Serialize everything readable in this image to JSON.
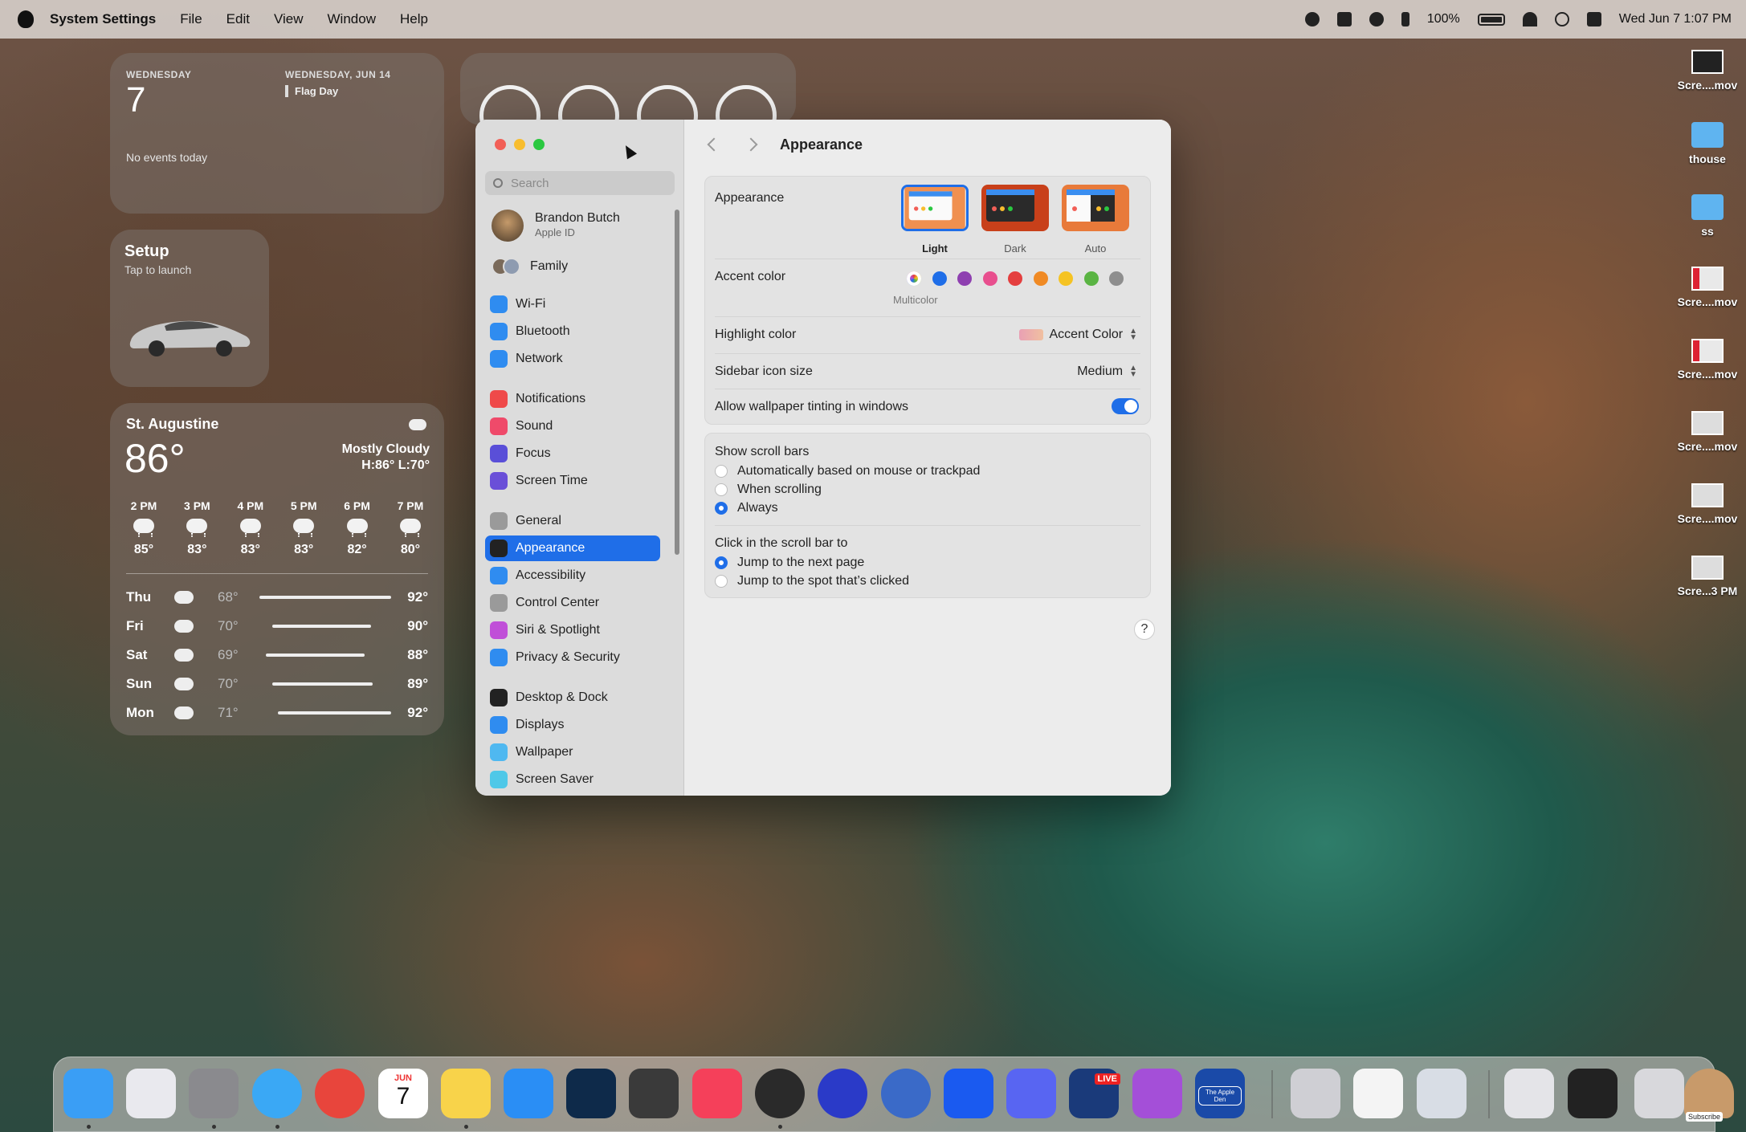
{
  "menubar": {
    "app_name": "System Settings",
    "menus": [
      "File",
      "Edit",
      "View",
      "Window",
      "Help"
    ],
    "battery": "100%",
    "clock": "Wed Jun 7  1:07 PM",
    "status_icons": [
      "screen-record-icon",
      "dropbox-icon",
      "play-icon",
      "bluetooth-icon",
      "battery-icon",
      "wifi-icon",
      "spotlight-icon",
      "control-center-icon"
    ]
  },
  "calendar_widget": {
    "today_dow": "WEDNESDAY",
    "today_day": "7",
    "no_events": "No events today",
    "next_date": "WEDNESDAY, JUN 14",
    "next_event": "Flag Day"
  },
  "tesla_widget": {
    "title": "Setup",
    "subtitle": "Tap to launch"
  },
  "weather_widget": {
    "city": "St. Augustine",
    "temp": "86°",
    "condition": "Mostly Cloudy",
    "hilo": "H:86° L:70°",
    "hourly": [
      {
        "time": "2 PM",
        "temp": "85°"
      },
      {
        "time": "3 PM",
        "temp": "83°"
      },
      {
        "time": "4 PM",
        "temp": "83°"
      },
      {
        "time": "5 PM",
        "temp": "83°"
      },
      {
        "time": "6 PM",
        "temp": "82°"
      },
      {
        "time": "7 PM",
        "temp": "80°"
      }
    ],
    "daily": [
      {
        "day": "Thu",
        "lo": "68°",
        "hi": "92°"
      },
      {
        "day": "Fri",
        "lo": "70°",
        "hi": "90°"
      },
      {
        "day": "Sat",
        "lo": "69°",
        "hi": "88°"
      },
      {
        "day": "Sun",
        "lo": "70°",
        "hi": "89°"
      },
      {
        "day": "Mon",
        "lo": "71°",
        "hi": "92°"
      }
    ]
  },
  "desktop_icons": [
    {
      "label": "Scre....mov",
      "kind": "video-thumbnail-icon"
    },
    {
      "label": "thouse",
      "kind": "folder-icon"
    },
    {
      "label": "ss",
      "kind": "folder-icon"
    },
    {
      "label": "Scre....mov",
      "kind": "video-thumbnail-icon"
    },
    {
      "label": "Scre....mov",
      "kind": "video-thumbnail-icon"
    },
    {
      "label": "Scre....mov",
      "kind": "video-thumbnail-icon"
    },
    {
      "label": "Scre....mov",
      "kind": "video-thumbnail-icon"
    },
    {
      "label": "Scre...3 PM",
      "kind": "image-thumbnail-icon"
    }
  ],
  "settings": {
    "search_placeholder": "Search",
    "user": {
      "name": "Brandon Butch",
      "sub": "Apple ID"
    },
    "family": "Family",
    "sidebar": [
      {
        "label": "Wi-Fi",
        "color": "#2f8cf0",
        "icon": "wifi-icon"
      },
      {
        "label": "Bluetooth",
        "color": "#2f8cf0",
        "icon": "bluetooth-icon"
      },
      {
        "label": "Network",
        "color": "#2f8cf0",
        "icon": "globe-icon"
      },
      {
        "label": "Notifications",
        "color": "#ef4a4a",
        "icon": "bell-icon"
      },
      {
        "label": "Sound",
        "color": "#ef4a6a",
        "icon": "speaker-icon"
      },
      {
        "label": "Focus",
        "color": "#5a4fd8",
        "icon": "moon-icon"
      },
      {
        "label": "Screen Time",
        "color": "#6a4fd8",
        "icon": "hourglass-icon"
      },
      {
        "label": "General",
        "color": "#9a9a9a",
        "icon": "gear-icon"
      },
      {
        "label": "Appearance",
        "color": "#222222",
        "icon": "appearance-icon"
      },
      {
        "label": "Accessibility",
        "color": "#2f8cf0",
        "icon": "accessibility-icon"
      },
      {
        "label": "Control Center",
        "color": "#9a9a9a",
        "icon": "switches-icon"
      },
      {
        "label": "Siri & Spotlight",
        "color": "#c04fd8",
        "icon": "siri-icon"
      },
      {
        "label": "Privacy & Security",
        "color": "#2f8cf0",
        "icon": "hand-icon"
      },
      {
        "label": "Desktop & Dock",
        "color": "#222222",
        "icon": "dock-icon"
      },
      {
        "label": "Displays",
        "color": "#2f8cf0",
        "icon": "sun-icon"
      },
      {
        "label": "Wallpaper",
        "color": "#4fb8f0",
        "icon": "flower-icon"
      },
      {
        "label": "Screen Saver",
        "color": "#4fc8e8",
        "icon": "screensaver-icon"
      }
    ],
    "selected": "Appearance",
    "title": "Appearance",
    "appearance_label": "Appearance",
    "themes": [
      "Light",
      "Dark",
      "Auto"
    ],
    "accent_label": "Accent color",
    "accent_colors": [
      "#b94fd8",
      "#1f6ee8",
      "#8e3fb0",
      "#e84f8e",
      "#e43e3e",
      "#f08a24",
      "#f5c323",
      "#5ab443",
      "#8e8e8e"
    ],
    "multicolor": "Multicolor",
    "highlight_label": "Highlight color",
    "highlight_value": "Accent Color",
    "sidebar_size_label": "Sidebar icon size",
    "sidebar_size_value": "Medium",
    "tinting_label": "Allow wallpaper tinting in windows",
    "tinting_on": true,
    "scroll_label": "Show scroll bars",
    "scroll_options": [
      "Automatically based on mouse or trackpad",
      "When scrolling",
      "Always"
    ],
    "scroll_selected": "Always",
    "click_label": "Click in the scroll bar to",
    "click_options": [
      "Jump to the next page",
      "Jump to the spot that’s clicked"
    ],
    "click_selected": "Jump to the next page",
    "help": "?"
  },
  "dock": {
    "apps": [
      {
        "name": "finder-icon",
        "color": "#3a9ef5"
      },
      {
        "name": "launchpad-icon",
        "color": "#e9e9ee"
      },
      {
        "name": "system-settings-icon",
        "color": "#8a8a8e"
      },
      {
        "name": "safari-icon",
        "color": "#3aa8f5"
      },
      {
        "name": "chrome-icon",
        "color": "#e8453c"
      },
      {
        "name": "calendar-icon",
        "color": "#ffffff"
      },
      {
        "name": "notes-icon",
        "color": "#f8d34a"
      },
      {
        "name": "app-store-icon",
        "color": "#2a8ef5"
      },
      {
        "name": "photoshop-icon",
        "color": "#0e2a4a"
      },
      {
        "name": "final-cut-icon",
        "color": "#3a3a3a"
      },
      {
        "name": "music-icon",
        "color": "#f5405a"
      },
      {
        "name": "quicktime-icon",
        "color": "#2a2a2a"
      },
      {
        "name": "podcast-app-icon",
        "color": "#2a3ac8"
      },
      {
        "name": "wire-icon",
        "color": "#3a6ac8"
      },
      {
        "name": "mimestream-icon",
        "color": "#1a5af0"
      },
      {
        "name": "discord-icon",
        "color": "#5865f2"
      },
      {
        "name": "live-stream-icon",
        "color": "#1a3a7a"
      },
      {
        "name": "feedback-icon",
        "color": "#a44fd8"
      },
      {
        "name": "apple-den-icon",
        "color": "#1a4aa8"
      },
      {
        "name": "printer-icon",
        "color": "#cfcfd4"
      },
      {
        "name": "reminders-icon",
        "color": "#f4f4f4"
      },
      {
        "name": "preview-icon",
        "color": "#d8dde5"
      },
      {
        "name": "window-icon",
        "color": "#e4e4e8"
      },
      {
        "name": "terminal-window-icon",
        "color": "#222222"
      },
      {
        "name": "trash-icon",
        "color": "#d8d8dc"
      },
      {
        "name": "avatar-icon",
        "color": "#c89a6a"
      }
    ],
    "calendar_month": "JUN",
    "calendar_day": "7",
    "live_badge": "LIVE",
    "subscribe": "Subscribe",
    "apple_den_label": "The Apple Den"
  }
}
